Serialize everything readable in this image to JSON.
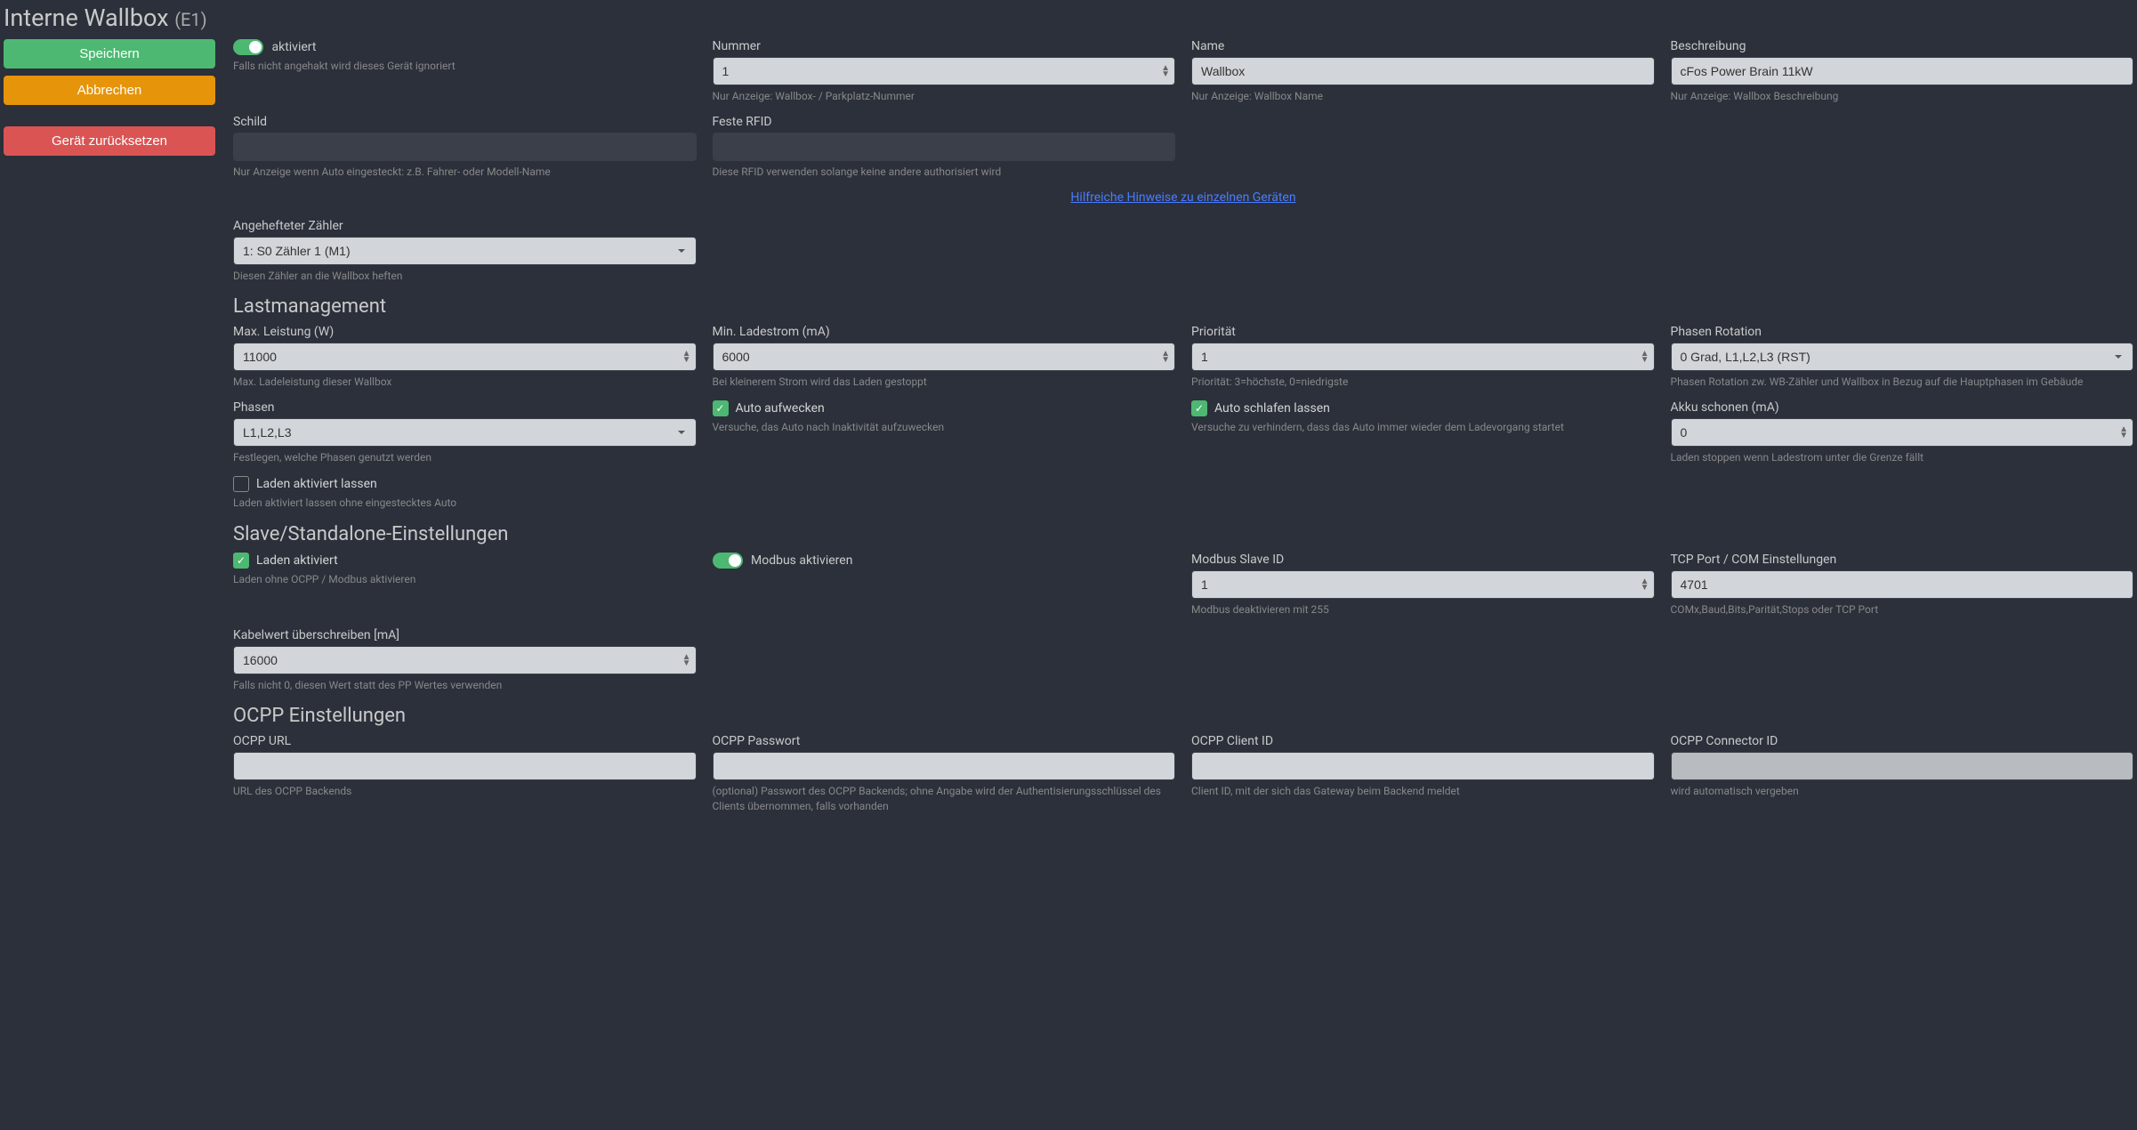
{
  "header": {
    "title": "Interne Wallbox",
    "suffix": "(E1)"
  },
  "buttons": {
    "save": "Speichern",
    "cancel": "Abbrechen",
    "reset": "Gerät zurücksetzen"
  },
  "activate": {
    "label": "aktiviert",
    "value": true,
    "hint": "Falls nicht angehakt wird dieses Gerät ignoriert"
  },
  "fields": {
    "number": {
      "label": "Nummer",
      "value": "1",
      "hint": "Nur Anzeige: Wallbox- / Parkplatz-Nummer"
    },
    "name": {
      "label": "Name",
      "value": "Wallbox",
      "hint": "Nur Anzeige: Wallbox Name"
    },
    "description": {
      "label": "Beschreibung",
      "value": "cFos Power Brain 11kW",
      "hint": "Nur Anzeige: Wallbox Beschreibung"
    },
    "schild": {
      "label": "Schild",
      "value": "",
      "hint": "Nur Anzeige wenn Auto eingesteckt: z.B. Fahrer- oder Modell-Name"
    },
    "rfid": {
      "label": "Feste RFID",
      "value": "",
      "hint": "Diese RFID verwenden solange keine andere authorisiert wird"
    },
    "attachedMeter": {
      "label": "Angehefteter Zähler",
      "value": "1: S0 Zähler 1 (M1)",
      "hint": "Diesen Zähler an die Wallbox heften"
    }
  },
  "help_link": "Hilfreiche Hinweise zu einzelnen Geräten",
  "sections": {
    "load": "Lastmanagement",
    "slave": "Slave/Standalone-Einstellungen",
    "ocpp": "OCPP Einstellungen"
  },
  "load": {
    "maxPower": {
      "label": "Max. Leistung (W)",
      "value": "11000",
      "hint": "Max. Ladeleistung dieser Wallbox"
    },
    "minCurrent": {
      "label": "Min. Ladestrom (mA)",
      "value": "6000",
      "hint": "Bei kleinerem Strom wird das Laden gestoppt"
    },
    "priority": {
      "label": "Priorität",
      "value": "1",
      "hint": "Priorität: 3=höchste, 0=niedrigste"
    },
    "phaseRotation": {
      "label": "Phasen Rotation",
      "value": "0 Grad, L1,L2,L3 (RST)",
      "hint": "Phasen Rotation zw. WB-Zähler und Wallbox in Bezug auf die Hauptphasen im Gebäude"
    },
    "phases": {
      "label": "Phasen",
      "value": "L1,L2,L3",
      "hint": "Festlegen, welche Phasen genutzt werden"
    },
    "wakeCar": {
      "label": "Auto aufwecken",
      "value": true,
      "hint": "Versuche, das Auto nach Inaktivität aufzuwecken"
    },
    "letSleep": {
      "label": "Auto schlafen lassen",
      "value": true,
      "hint": "Versuche zu verhindern, dass das Auto immer wieder dem Ladevorgang startet"
    },
    "akkuSchonen": {
      "label": "Akku schonen (mA)",
      "value": "0",
      "hint": "Laden stoppen wenn Ladestrom unter die Grenze fällt"
    },
    "keepCharging": {
      "label": "Laden aktiviert lassen",
      "value": false,
      "hint": "Laden aktiviert lassen ohne eingestecktes Auto"
    }
  },
  "slave": {
    "chargingActive": {
      "label": "Laden aktiviert",
      "value": true,
      "hint": "Laden ohne OCPP / Modbus aktivieren"
    },
    "modbusActive": {
      "label": "Modbus aktivieren",
      "value": true
    },
    "modbusId": {
      "label": "Modbus Slave ID",
      "value": "1",
      "hint": "Modbus deaktivieren mit 255"
    },
    "tcpPort": {
      "label": "TCP Port / COM Einstellungen",
      "value": "4701",
      "hint": "COMx,Baud,Bits,Parität,Stops oder TCP Port"
    },
    "cableOverride": {
      "label": "Kabelwert überschreiben [mA]",
      "value": "16000",
      "hint": "Falls nicht 0, diesen Wert statt des PP Wertes verwenden"
    }
  },
  "ocpp": {
    "url": {
      "label": "OCPP URL",
      "value": "",
      "hint": "URL des OCPP Backends"
    },
    "password": {
      "label": "OCPP Passwort",
      "value": "",
      "hint": "(optional) Passwort des OCPP Backends; ohne Angabe wird der Authentisierungsschlüssel des Clients übernommen, falls vorhanden"
    },
    "clientId": {
      "label": "OCPP Client ID",
      "value": "",
      "hint": "Client ID, mit der sich das Gateway beim Backend meldet"
    },
    "connectorId": {
      "label": "OCPP Connector ID",
      "value": "",
      "hint": "wird automatisch vergeben"
    }
  }
}
